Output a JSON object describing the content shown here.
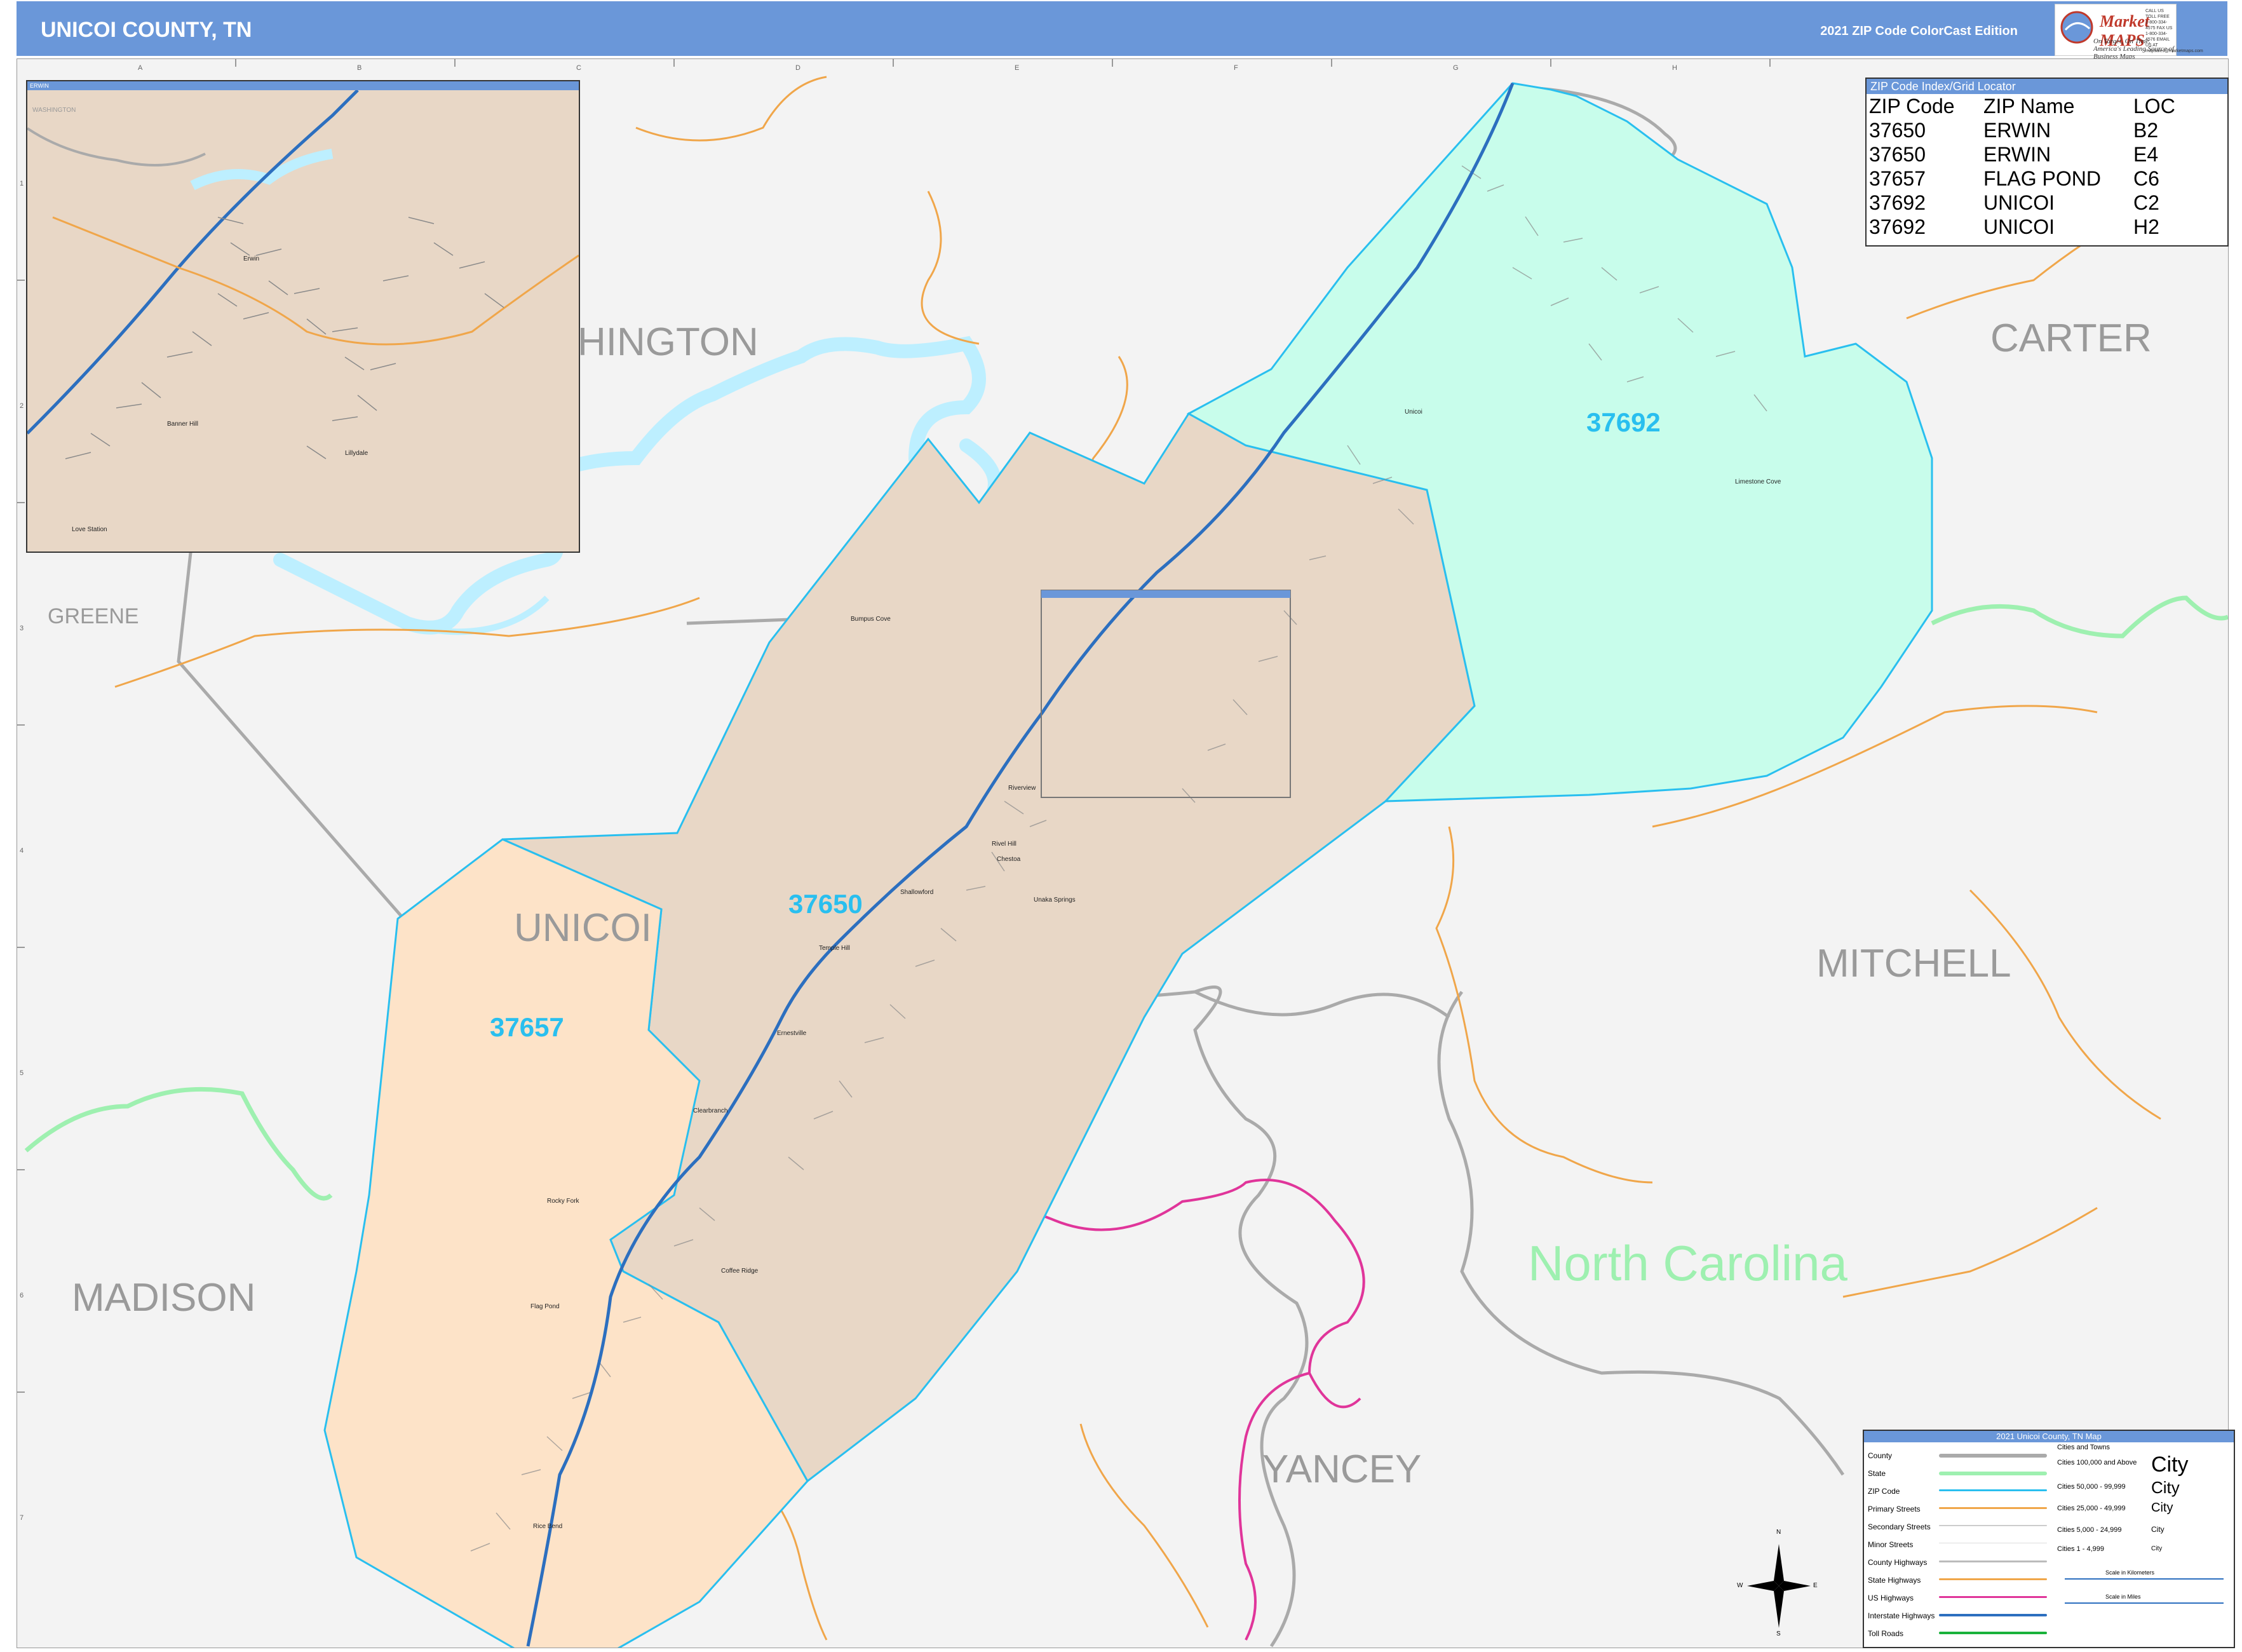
{
  "header": {
    "title": "UNICOI COUNTY, TN",
    "edition": "2021 ZIP Code ColorCast Edition",
    "logo_name": "Market MAPS",
    "logo_tagline": "On Target, On Time. America's Leading Source of Business Maps",
    "logo_contact": "CALL US TOLL FREE 1-800-334-4575 FAX US 1-800-334-4576 EMAIL US AT mapsales@marketmaps.com"
  },
  "colors": {
    "header_bg": "#6a97d9",
    "zip_37650": "#e8d7c6",
    "zip_37657": "#fde3c8",
    "zip_37692": "#c8fdeb",
    "zip_border": "#29bfef",
    "state_line": "#9ef0b0",
    "county_line": "#aaaaaa",
    "primary_street": "#f0a64a",
    "interstate": "#2c6fbf",
    "us_highway": "#e0359a",
    "water": "#bdefff"
  },
  "grid": {
    "letters": [
      "A",
      "B",
      "C",
      "D",
      "E",
      "F",
      "G",
      "H"
    ],
    "numbers": [
      "1",
      "2",
      "3",
      "4",
      "5",
      "6",
      "7"
    ]
  },
  "zip_index": {
    "title": "ZIP Code Index/Grid Locator",
    "headers": [
      "ZIP Code",
      "ZIP Name",
      "LOC"
    ],
    "rows": [
      [
        "37650",
        "ERWIN",
        "B2"
      ],
      [
        "37650",
        "ERWIN",
        "E4"
      ],
      [
        "37657",
        "FLAG POND",
        "C6"
      ],
      [
        "37692",
        "UNICOI",
        "C2"
      ],
      [
        "37692",
        "UNICOI",
        "H2"
      ]
    ]
  },
  "map_labels": {
    "counties": [
      "HINGTON",
      "CARTER",
      "GREENE",
      "UNICOI",
      "MITCHELL",
      "MADISON",
      "YANCEY"
    ],
    "state": "North Carolina",
    "zips": [
      "37692",
      "37650",
      "37657"
    ],
    "places": [
      "Bumpus Cove",
      "Unicoi",
      "Limestone Cove",
      "Riverview",
      "Rivel Hill",
      "Chestoa",
      "Unaka Springs",
      "Shallowford",
      "Temple Hill",
      "Ernestville",
      "Clearbranch",
      "Rocky Fork",
      "Coffee Ridge",
      "Flag Pond",
      "Rice Bend",
      "Erwin"
    ]
  },
  "inset": {
    "title": "ERWIN",
    "county_label": "WASHINGTON",
    "places": [
      "Erwin",
      "Banner Hill",
      "Lillydale",
      "Love Station"
    ]
  },
  "legend": {
    "title": "2021 Unicoi County, TN Map",
    "rows": [
      "County",
      "State",
      "ZIP Code",
      "Primary Streets",
      "Secondary Streets",
      "Minor Streets",
      "County Highways",
      "State Highways",
      "US Highways",
      "Interstate Highways",
      "Toll Roads"
    ],
    "cities_header": "Cities and Towns",
    "city_tiers": [
      "Cities 100,000 and Above",
      "Cities 50,000 - 99,999",
      "Cities 25,000 - 49,999",
      "Cities 5,000 - 24,999",
      "Cities 1 - 4,999"
    ],
    "city_sample": "City",
    "scale_km": "Scale in Kilometers",
    "scale_mi": "Scale in Miles"
  },
  "compass": {
    "n": "N",
    "s": "S",
    "e": "E",
    "w": "W"
  }
}
